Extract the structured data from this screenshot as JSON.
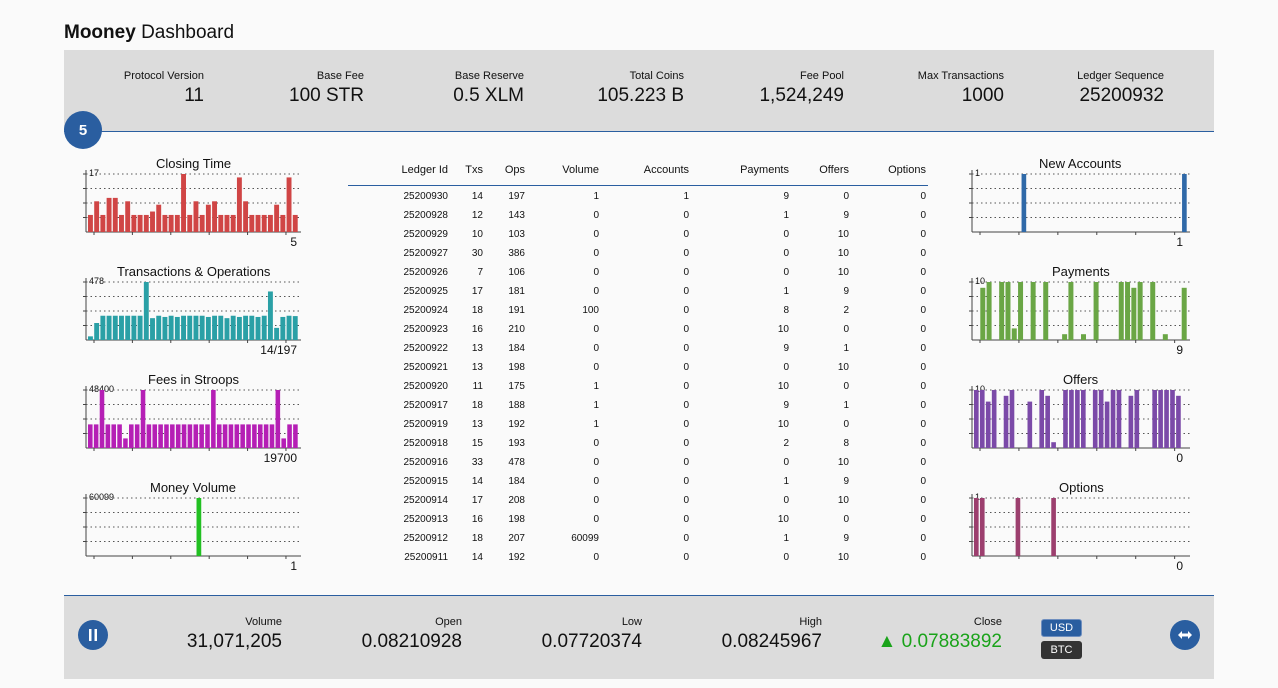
{
  "app": {
    "brand": "Mooney",
    "subtitle": "Dashboard"
  },
  "stats": [
    {
      "label": "Protocol Version",
      "value": "11"
    },
    {
      "label": "Base Fee",
      "value": "100 STR"
    },
    {
      "label": "Base Reserve",
      "value": "0.5 XLM"
    },
    {
      "label": "Total Coins",
      "value": "105.223 B"
    },
    {
      "label": "Fee Pool",
      "value": "1,524,249"
    },
    {
      "label": "Max Transactions",
      "value": "1000"
    },
    {
      "label": "Ledger Sequence",
      "value": "25200932"
    }
  ],
  "ledger_badge": "5",
  "colors": {
    "accent": "#2a5ea0",
    "closing": "#d04545",
    "txops": "#2aa0a6",
    "fees": "#b51fb5",
    "volume": "#22c022",
    "new_accounts": "#2f69a8",
    "payments": "#6aa645",
    "offers": "#7b4aa8",
    "options": "#9c3f6e",
    "up": "#1aa31a",
    "usd": "#2a5ea0",
    "btc": "#333333"
  },
  "sparks": {
    "closing": {
      "title": "Closing Time",
      "max": "17",
      "current": "5"
    },
    "txops": {
      "title": "Transactions & Operations",
      "max": "478",
      "current": "14/197"
    },
    "fees": {
      "title": "Fees in Stroops",
      "max": "48400",
      "current": "19700"
    },
    "volume": {
      "title": "Money Volume",
      "max": "60099",
      "current": "1"
    },
    "new_accounts": {
      "title": "New Accounts",
      "max": "1",
      "current": "1"
    },
    "payments": {
      "title": "Payments",
      "max": "10",
      "current": "9"
    },
    "offers": {
      "title": "Offers",
      "max": "10",
      "current": "0"
    },
    "options": {
      "title": "Options",
      "max": "1",
      "current": "0"
    }
  },
  "table": {
    "headers": {
      "id": "Ledger Id",
      "txs": "Txs",
      "ops": "Ops",
      "volume": "Volume",
      "accounts": "Accounts",
      "payments": "Payments",
      "offers": "Offers",
      "options": "Options"
    },
    "rows": [
      [
        "25200930",
        "14",
        "197",
        "1",
        "1",
        "9",
        "0",
        "0"
      ],
      [
        "25200928",
        "12",
        "143",
        "0",
        "0",
        "1",
        "9",
        "0"
      ],
      [
        "25200929",
        "10",
        "103",
        "0",
        "0",
        "0",
        "10",
        "0"
      ],
      [
        "25200927",
        "30",
        "386",
        "0",
        "0",
        "0",
        "10",
        "0"
      ],
      [
        "25200926",
        "7",
        "106",
        "0",
        "0",
        "0",
        "10",
        "0"
      ],
      [
        "25200925",
        "17",
        "181",
        "0",
        "0",
        "1",
        "9",
        "0"
      ],
      [
        "25200924",
        "18",
        "191",
        "100",
        "0",
        "8",
        "2",
        "0"
      ],
      [
        "25200923",
        "16",
        "210",
        "0",
        "0",
        "10",
        "0",
        "0"
      ],
      [
        "25200922",
        "13",
        "184",
        "0",
        "0",
        "9",
        "1",
        "0"
      ],
      [
        "25200921",
        "13",
        "198",
        "0",
        "0",
        "0",
        "10",
        "0"
      ],
      [
        "25200920",
        "11",
        "175",
        "1",
        "0",
        "10",
        "0",
        "0"
      ],
      [
        "25200917",
        "18",
        "188",
        "1",
        "0",
        "9",
        "1",
        "0"
      ],
      [
        "25200919",
        "13",
        "192",
        "1",
        "0",
        "10",
        "0",
        "0"
      ],
      [
        "25200918",
        "15",
        "193",
        "0",
        "0",
        "2",
        "8",
        "0"
      ],
      [
        "25200916",
        "33",
        "478",
        "0",
        "0",
        "0",
        "10",
        "0"
      ],
      [
        "25200915",
        "14",
        "184",
        "0",
        "0",
        "1",
        "9",
        "0"
      ],
      [
        "25200914",
        "17",
        "208",
        "0",
        "0",
        "0",
        "10",
        "0"
      ],
      [
        "25200913",
        "16",
        "198",
        "0",
        "0",
        "10",
        "0",
        "0"
      ],
      [
        "25200912",
        "18",
        "207",
        "60099",
        "0",
        "1",
        "9",
        "0"
      ],
      [
        "25200911",
        "14",
        "192",
        "0",
        "0",
        "0",
        "10",
        "0"
      ]
    ]
  },
  "market": [
    {
      "label": "Volume",
      "value": "31,071,205"
    },
    {
      "label": "Open",
      "value": "0.08210928"
    },
    {
      "label": "Low",
      "value": "0.07720374"
    },
    {
      "label": "High",
      "value": "0.08245967"
    },
    {
      "label": "Close",
      "value": "▲ 0.07883892"
    }
  ],
  "currency": {
    "usd": "USD",
    "btc": "BTC"
  },
  "controls": {
    "pause_icon": "pause-icon",
    "swap_icon": "swap-icon"
  }
}
